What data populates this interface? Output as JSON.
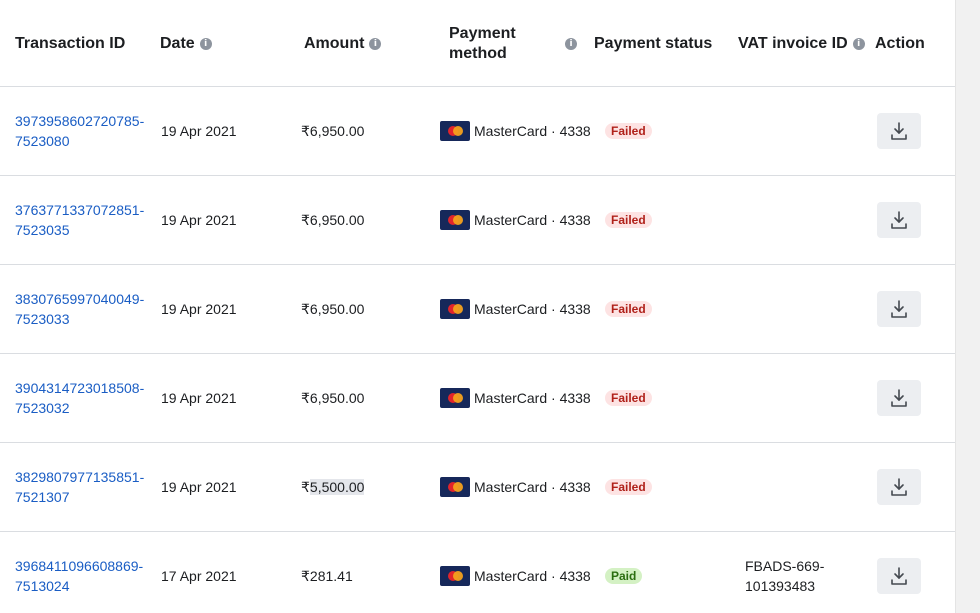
{
  "headers": {
    "transaction_id": "Transaction ID",
    "date": "Date",
    "amount": "Amount",
    "payment_method_line1": "Payment",
    "payment_method_line2": "method",
    "payment_status": "Payment status",
    "vat_invoice_id": "VAT invoice ID",
    "action": "Action"
  },
  "rows": [
    {
      "tx_line1": "3973958602720785-",
      "tx_line2": "7523080",
      "date": "19 Apr 2021",
      "amount": "₹6,950.00",
      "method": "MasterCard · 4338",
      "status": "Failed",
      "vat_line1": "",
      "vat_line2": ""
    },
    {
      "tx_line1": "3763771337072851-",
      "tx_line2": "7523035",
      "date": "19 Apr 2021",
      "amount": "₹6,950.00",
      "method": "MasterCard · 4338",
      "status": "Failed",
      "vat_line1": "",
      "vat_line2": ""
    },
    {
      "tx_line1": "3830765997040049-",
      "tx_line2": "7523033",
      "date": "19 Apr 2021",
      "amount": "₹6,950.00",
      "method": "MasterCard · 4338",
      "status": "Failed",
      "vat_line1": "",
      "vat_line2": ""
    },
    {
      "tx_line1": "3904314723018508-",
      "tx_line2": "7523032",
      "date": "19 Apr 2021",
      "amount": "₹6,950.00",
      "method": "MasterCard · 4338",
      "status": "Failed",
      "vat_line1": "",
      "vat_line2": ""
    },
    {
      "tx_line1": "3829807977135851-",
      "tx_line2": "7521307",
      "date": "19 Apr 2021",
      "amount_symbol": "₹",
      "amount_highlighted": "5,500.00",
      "method": "MasterCard · 4338",
      "status": "Failed",
      "vat_line1": "",
      "vat_line2": ""
    },
    {
      "tx_line1": "3968411096608869-",
      "tx_line2": "7513024",
      "date": "17 Apr 2021",
      "amount": "₹281.41",
      "method": "MasterCard · 4338",
      "status": "Paid",
      "vat_line1": "FBADS-669-",
      "vat_line2": "101393483"
    }
  ],
  "icons": {
    "info": "info-icon",
    "card": "mastercard-icon",
    "download": "download-icon"
  },
  "colors": {
    "link": "#1a5dc4",
    "failed_bg": "#fde3e3",
    "failed_text": "#b0211a",
    "paid_bg": "#d4f1c4",
    "paid_text": "#2b6e10"
  }
}
